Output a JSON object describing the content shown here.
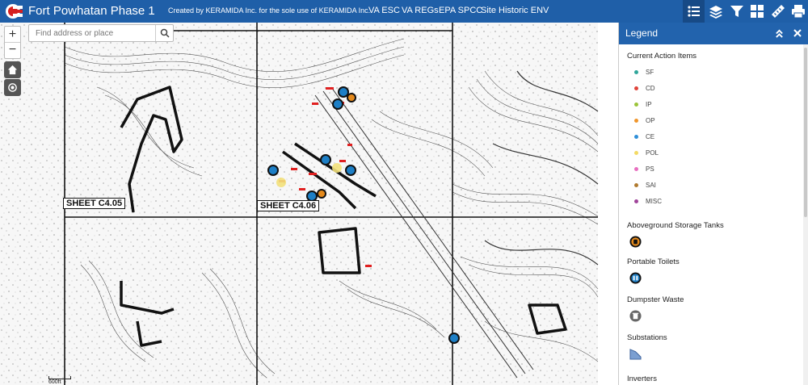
{
  "header": {
    "title": "Fort Powhatan Phase 1",
    "subtitle": "Created by KERAMIDA Inc. for the sole use of KERAMIDA Inc.",
    "links": [
      "VA ESC",
      "VA REGs",
      "EPA SPCC",
      "Site Historic ENV"
    ],
    "tools": [
      "legend-icon",
      "layers-icon",
      "filter-icon",
      "basemap-gallery-icon",
      "measure-icon",
      "print-icon"
    ],
    "color": "#1f5fa8"
  },
  "map": {
    "search": {
      "placeholder": "Find address or place",
      "value": ""
    },
    "zoom_in": "+",
    "zoom_out": "−",
    "scale": "600ft",
    "sheet_labels": [
      "SHEET C4.05",
      "SHEET C4.06"
    ],
    "marker_colors": {
      "toilet": "#1d7fc6",
      "tank": "#e58a1c",
      "highlight": "#f2e07a",
      "flag": "#e02020"
    }
  },
  "legend": {
    "title": "Legend",
    "current_action_items": {
      "title": "Current Action Items",
      "items": [
        {
          "label": "SF",
          "color": "#2fa69a"
        },
        {
          "label": "CD",
          "color": "#e0433a"
        },
        {
          "label": "IP",
          "color": "#9bc43a"
        },
        {
          "label": "OP",
          "color": "#f0962c"
        },
        {
          "label": "CE",
          "color": "#2f8fd8"
        },
        {
          "label": "POL",
          "color": "#f3da64"
        },
        {
          "label": "PS",
          "color": "#e86fc0"
        },
        {
          "label": "SAI",
          "color": "#b07a2e"
        },
        {
          "label": "MISC",
          "color": "#a0449a"
        }
      ]
    },
    "layers": [
      {
        "title": "Aboveground Storage Tanks",
        "icon": "storage-tank-icon"
      },
      {
        "title": "Portable Toilets",
        "icon": "portable-toilet-icon"
      },
      {
        "title": "Dumpster Waste",
        "icon": "dumpster-icon"
      },
      {
        "title": "Substations",
        "icon": "substation-icon"
      },
      {
        "title": "Inverters",
        "icon": "inverter-icon"
      }
    ]
  }
}
